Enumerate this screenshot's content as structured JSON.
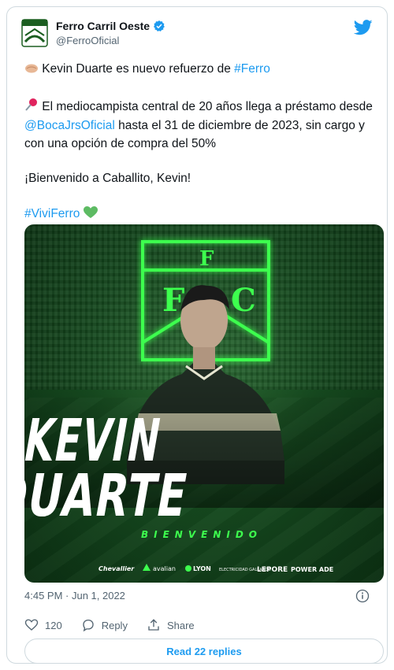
{
  "header": {
    "display_name": "Ferro Carril Oeste",
    "handle": "@FerroOficial"
  },
  "tweet": {
    "line1_text": " Kevin Duarte es nuevo refuerzo de ",
    "line1_hashtag": "#Ferro",
    "para2_a": " El mediocampista central de 20 años llega a préstamo desde ",
    "para2_mention": "@BocaJrsOficial",
    "para2_b": " hasta el 31 de diciembre de 2023, sin cargo y con una opción de compra del 50%",
    "para3": "¡Bienvenido a Caballito, Kevin!",
    "hashtag2": "#ViviFerro"
  },
  "media": {
    "name_line1": "KEVIN",
    "name_line2": "DUARTE",
    "subtitle": "BIENVENIDO",
    "crest_letters": "F",
    "crest_side_left": "F",
    "crest_side_right": "C",
    "sponsors": [
      "Chevallier",
      "avalian",
      "LYON",
      "ELECTRICIDAD GALLARDO",
      "LEPORE",
      "POWER ADE"
    ]
  },
  "meta": {
    "timestamp": "4:45 PM · Jun 1, 2022"
  },
  "actions": {
    "like_count": "120",
    "reply_label": "Reply",
    "share_label": "Share"
  },
  "read_replies_label": "Read 22 replies",
  "colors": {
    "link": "#1d9bf0",
    "neon_green": "#3dff4e",
    "dark_green": "#164a1f"
  }
}
